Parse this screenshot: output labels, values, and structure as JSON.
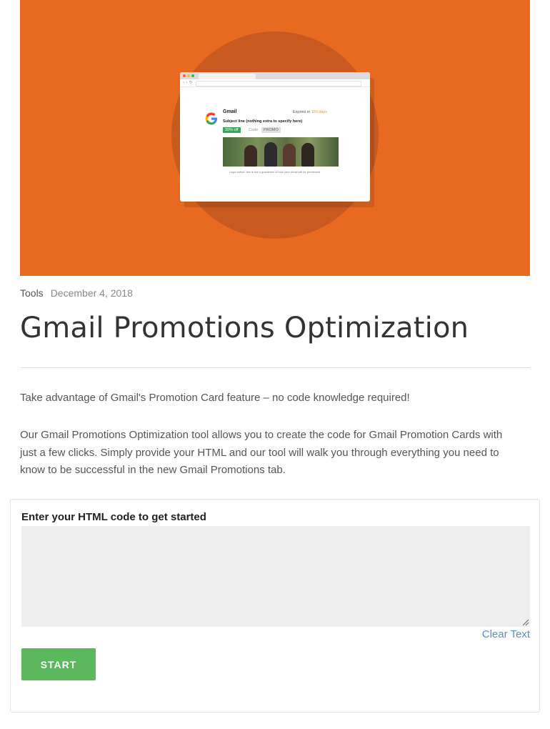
{
  "hero": {
    "card": {
      "sender": "Gmail",
      "expires_prefix": "Expires in",
      "expires_days": "160 days",
      "subject": "Subject line (nothing extra to specify here)",
      "discount": "20% off",
      "code_label": "Code",
      "code": "PROMO",
      "legal": "Legal notice: this is not a guarantee of how your email will be previewed.",
      "logo_letter": "G"
    },
    "colors": {
      "background": "#e86a21",
      "circle": "#c85a20"
    }
  },
  "post": {
    "category": "Tools",
    "date": "December 4, 2018",
    "title": "Gmail Promotions Optimization",
    "intro": "Take advantage of Gmail's Promotion Card feature – no code knowledge required!",
    "description": "Our Gmail Promotions Optimization tool allows you to create the code for Gmail Promotion Cards with just a few clicks. Simply provide your HTML and our tool will walk you through everything you need to know to be successful in the new Gmail Promotions tab."
  },
  "tool": {
    "label": "Enter your HTML code to get started",
    "code_value": "",
    "clear_label": "Clear Text",
    "start_label": "START",
    "colors": {
      "start": "#5cb85c",
      "clear_link": "#5b8ec9",
      "textarea": "#eeeeee"
    }
  }
}
